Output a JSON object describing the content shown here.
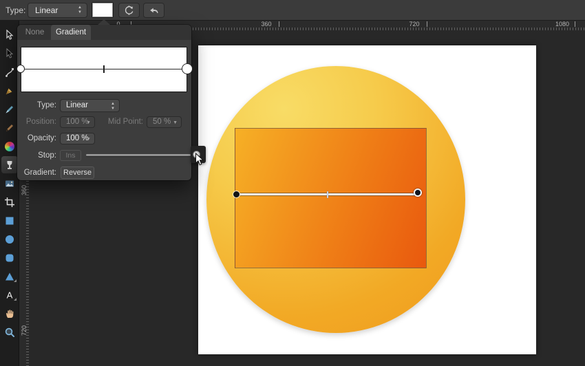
{
  "topbar": {
    "type_label": "Type:",
    "type_value": "Linear",
    "swatch_color": "#FFFFFF"
  },
  "rulers": {
    "horizontal_labels": [
      "0",
      "360",
      "720",
      "1080"
    ],
    "vertical_labels": [
      "360",
      "720"
    ]
  },
  "panel": {
    "tabs": {
      "none": "None",
      "gradient": "Gradient",
      "active": "Gradient"
    },
    "type_label": "Type:",
    "type_value": "Linear",
    "position_label": "Position:",
    "position_value": "100 %",
    "midpoint_label": "Mid Point:",
    "midpoint_value": "50 %",
    "opacity_label": "Opacity:",
    "opacity_value": "100 %",
    "stop_label": "Stop:",
    "insert_button_label": "Ins",
    "gradient_label": "Gradient:",
    "reverse_button_label": "Reverse"
  },
  "icon_glyphs": {
    "text_tool": "A"
  },
  "tools": [
    "move",
    "direct-select",
    "node-pen",
    "pen",
    "brush",
    "pencil",
    "color-wheel",
    "gradient-fill",
    "image",
    "crop",
    "rectangle-shape",
    "ellipse-shape",
    "rounded-rectangle-shape",
    "triangle-shape",
    "text",
    "hand",
    "zoom"
  ],
  "colors": {
    "circle_gradient": [
      "#F8DC66",
      "#F6CB4B",
      "#EF9A1D"
    ],
    "rect_gradient": [
      "#F6B026",
      "#E9590E"
    ],
    "shape_tool_blue": "#5C9FD6",
    "selected_stop_color": "#FFFFFF"
  }
}
